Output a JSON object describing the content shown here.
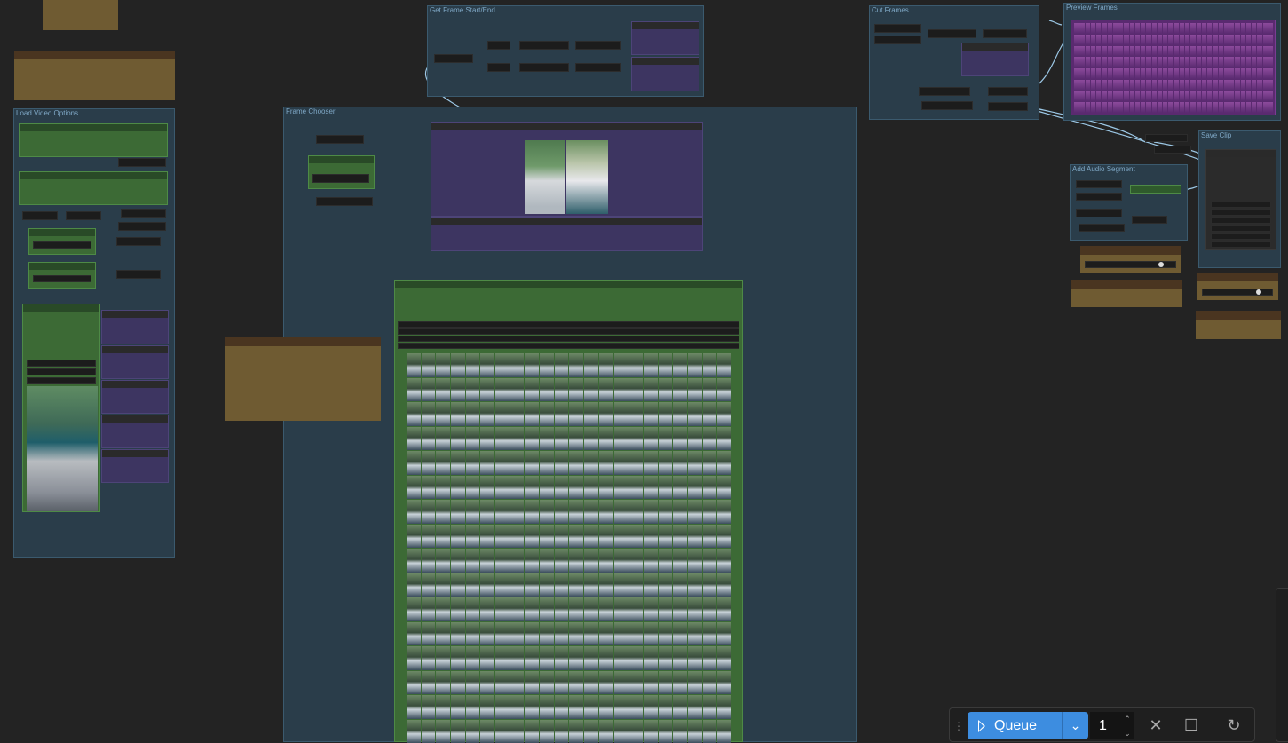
{
  "groups": {
    "load_video_options": "Load Video Options",
    "get_frame_start_end": "Get Frame Start/End",
    "frame_chooser": "Frame Chooser",
    "cut_frames": "Cut Frames",
    "preview_frames": "Preview Frames",
    "save_clip": "Save Clip",
    "add_audio_segment": "Add Audio Segment"
  },
  "toolbar": {
    "queue_label": "Queue",
    "batch_count": "1",
    "dropdown_icon": "chevron-down-icon",
    "up_icon": "chevron-up-icon",
    "down_icon": "chevron-down-icon",
    "cancel_icon": "close-icon",
    "stop_icon": "stop-icon",
    "refresh_icon": "refresh-icon",
    "accent_color": "#3d8de0"
  },
  "colors": {
    "canvas": "#232323",
    "group": "#2a3d4a",
    "node_green": "#3c6a35",
    "node_purple": "#3d3561",
    "note": "#6f5b32",
    "wire": "#8fbde0"
  }
}
